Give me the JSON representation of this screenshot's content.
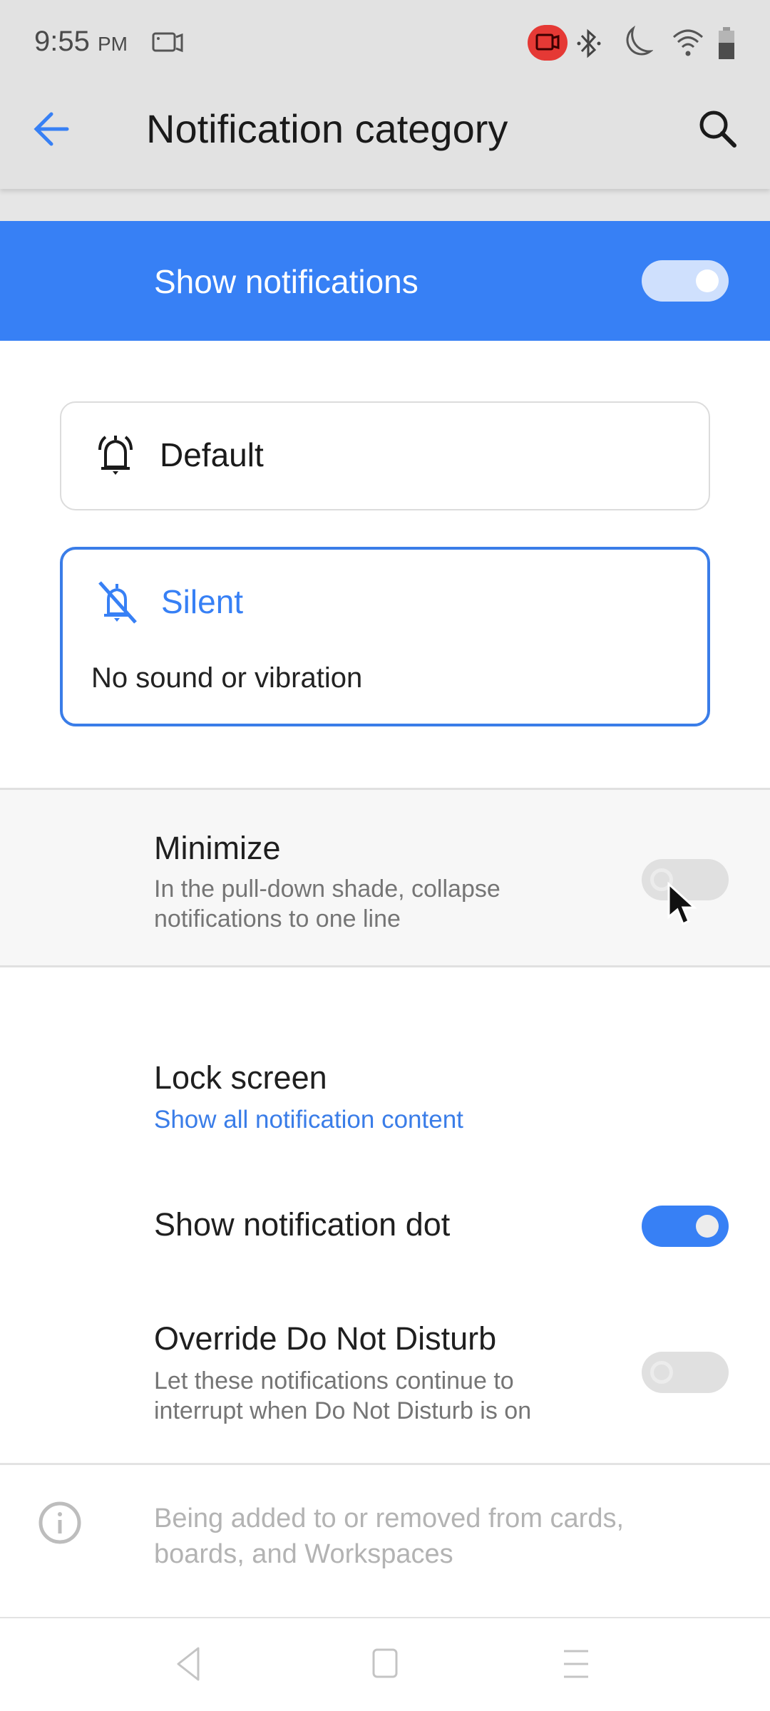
{
  "status_bar": {
    "time": "9:55",
    "ampm": "PM",
    "icons": [
      "screen-record-icon",
      "screen-record-active-icon",
      "bluetooth-icon",
      "do-not-disturb-moon-icon",
      "wifi-icon",
      "battery-icon"
    ]
  },
  "app_bar": {
    "back_icon": "arrow-left-icon",
    "title": "Notification category",
    "search_icon": "search-icon"
  },
  "master_toggle": {
    "label": "Show notifications",
    "on": true
  },
  "behavior_options": [
    {
      "label": "Default",
      "icon": "bell-ringing-icon",
      "selected": false
    },
    {
      "label": "Silent",
      "icon": "bell-off-icon",
      "selected": true,
      "description": "No sound or vibration"
    }
  ],
  "preferences": {
    "minimize": {
      "title": "Minimize",
      "subtitle_line1": "In the pull-down shade, collapse",
      "subtitle_line2": "notifications to one line",
      "on": false
    },
    "lock_screen": {
      "title": "Lock screen",
      "value": "Show all notification content"
    },
    "notification_dot": {
      "title": "Show notification dot",
      "on": true
    },
    "override_dnd": {
      "title": "Override Do Not Disturb",
      "subtitle_line1": "Let these notifications continue to",
      "subtitle_line2": "interrupt when Do Not Disturb is on",
      "on": false
    }
  },
  "info": {
    "icon": "info-icon",
    "line1": "Being added to or removed from cards,",
    "line2": "boards, and Workspaces"
  },
  "nav_bar": [
    "back-triangle-icon",
    "home-square-icon",
    "menu-lines-icon"
  ],
  "colors": {
    "accent": "#3780f5",
    "selected_border": "#3a7de8",
    "record_red": "#e53935"
  }
}
